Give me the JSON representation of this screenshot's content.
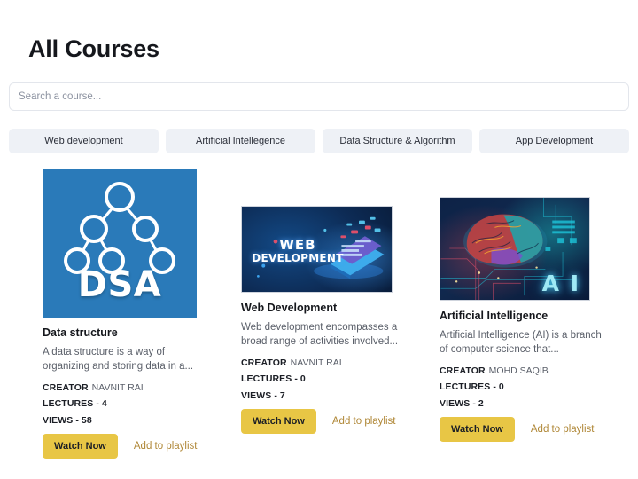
{
  "header": {
    "title": "All Courses"
  },
  "search": {
    "placeholder": "Search a course...",
    "value": ""
  },
  "filters": [
    {
      "label": "Web development"
    },
    {
      "label": "Artificial Intellegence"
    },
    {
      "label": "Data Structure & Algorithm"
    },
    {
      "label": "App Development"
    }
  ],
  "labels": {
    "creator": "CREATOR",
    "lectures": "LECTURES -",
    "views": "VIEWS -",
    "watch_now": "Watch Now",
    "add_to_playlist": "Add to playlist"
  },
  "courses": [
    {
      "title": "Data structure",
      "description": "A data structure is a way of organizing and storing data in a...",
      "creator": "NAVNIT RAI",
      "lectures": "4",
      "views": "58",
      "thumbnail": {
        "kind": "dsa-logo",
        "text": "DSA",
        "background": "#2a7ab9",
        "accent": "#ffffff"
      }
    },
    {
      "title": "Web Development",
      "description": "Web development encompasses a broad range of activities involved...",
      "creator": "NAVNIT RAI",
      "lectures": "0",
      "views": "7",
      "thumbnail": {
        "kind": "web-dev-banner",
        "line1": "WEB",
        "line2": "DEVELOPMENT",
        "background": "#0d2b55",
        "accent": "#4aa6f0"
      }
    },
    {
      "title": "Artificial Intelligence",
      "description": "Artificial Intelligence (AI) is a branch of computer science that...",
      "creator": "MOHD SAQIB",
      "lectures": "0",
      "views": "2",
      "thumbnail": {
        "kind": "ai-brain-circuit",
        "text": "A I",
        "background": "#0d2246",
        "accent": "#9fe9f5"
      }
    }
  ],
  "colors": {
    "page_background": "#ffffff",
    "filter_chip": "#eef1f6",
    "button_primary": "#e8c645",
    "link": "#b08838",
    "title": "#15171c",
    "body_text": "#5a5f69"
  }
}
